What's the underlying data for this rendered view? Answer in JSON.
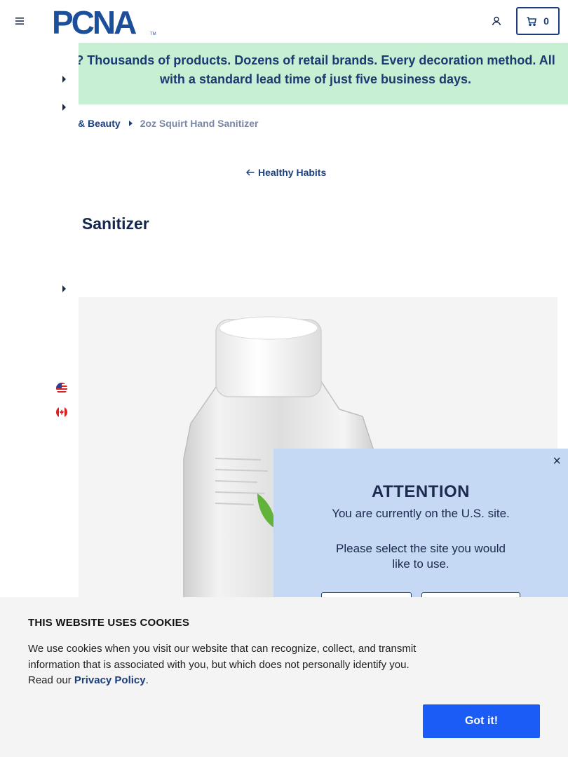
{
  "header": {
    "logo_text": "PCNA",
    "logo_tm": "TM",
    "cart_count": "0",
    "brand_color": "#1c3f7a"
  },
  "promo": {
    "text": "? Thousands of products. Dozens of retail brands. Every decoration method. All with a standard lead time of just five business days.",
    "background": "#c6efd3"
  },
  "breadcrumb": {
    "parent": "lth & Beauty",
    "current": "2oz Squirt Hand Sanitizer"
  },
  "back_link": {
    "label": "Healthy Habits"
  },
  "product": {
    "title": "rt Hand Sanitizer"
  },
  "site_prompt": {
    "title": "ATTENTION",
    "message": "You are currently on the U.S. site.",
    "prompt": "Please select the site you would like to use.",
    "close": "×",
    "background": "#c5d8f4"
  },
  "cookies": {
    "title": "THIS WEBSITE USES COOKIES",
    "body": "We use cookies when you visit our website that can recognize, collect, and transmit information that is associated with you, but which does not personally identify you. Read our ",
    "link": "Privacy Policy",
    "period": ".",
    "button": "Got it!",
    "button_color": "#1a5cf5"
  }
}
